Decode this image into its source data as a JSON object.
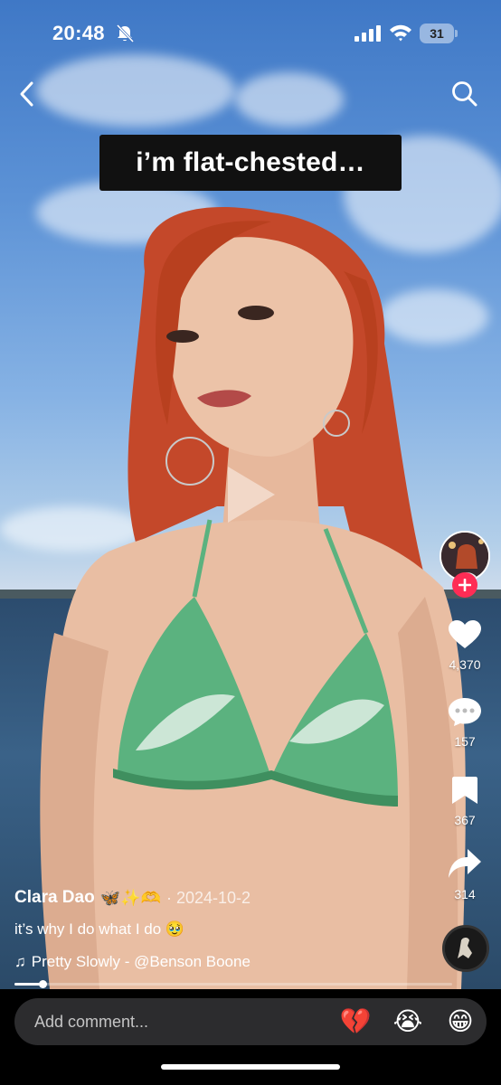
{
  "status_bar": {
    "time": "20:48",
    "battery": "31"
  },
  "overlay_caption": "i’m flat-chested…",
  "rail": {
    "likes": "4,370",
    "comments": "157",
    "saves": "367",
    "shares": "314"
  },
  "post": {
    "author": "Clara Dao",
    "author_emojis": "🦋✨🫶",
    "date": "· 2024-10-2",
    "description": "it’s why I do what I do 🥹",
    "music_icon": "♫",
    "music": "Pretty Slowly - @Benson Boone"
  },
  "playback": {
    "progress": 0.065
  },
  "comment_bar": {
    "placeholder": "Add comment...",
    "quick_emojis": [
      "💔",
      "😭",
      "😁"
    ]
  },
  "colors": {
    "follow": "#fe2c55",
    "comment_bg": "#2c2c2e"
  }
}
